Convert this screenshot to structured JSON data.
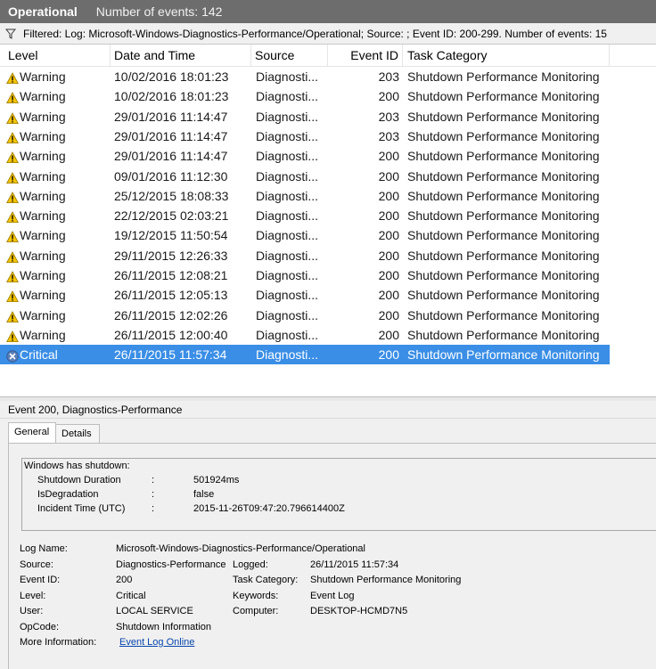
{
  "titlebar": {
    "title": "Operational",
    "count": "Number of events: 142"
  },
  "filter": {
    "text": "Filtered: Log: Microsoft-Windows-Diagnostics-Performance/Operational; Source: ; Event ID: 200-299. Number of events: 15"
  },
  "columns": {
    "level": "Level",
    "date": "Date and Time",
    "source": "Source",
    "eventid": "Event ID",
    "taskcat": "Task Category"
  },
  "rows": [
    {
      "level": "Warning",
      "date": "10/02/2016 18:01:23",
      "source": "Diagnosti...",
      "eventid": "203",
      "taskcat": "Shutdown Performance Monitoring"
    },
    {
      "level": "Warning",
      "date": "10/02/2016 18:01:23",
      "source": "Diagnosti...",
      "eventid": "200",
      "taskcat": "Shutdown Performance Monitoring"
    },
    {
      "level": "Warning",
      "date": "29/01/2016 11:14:47",
      "source": "Diagnosti...",
      "eventid": "203",
      "taskcat": "Shutdown Performance Monitoring"
    },
    {
      "level": "Warning",
      "date": "29/01/2016 11:14:47",
      "source": "Diagnosti...",
      "eventid": "203",
      "taskcat": "Shutdown Performance Monitoring"
    },
    {
      "level": "Warning",
      "date": "29/01/2016 11:14:47",
      "source": "Diagnosti...",
      "eventid": "200",
      "taskcat": "Shutdown Performance Monitoring"
    },
    {
      "level": "Warning",
      "date": "09/01/2016 11:12:30",
      "source": "Diagnosti...",
      "eventid": "200",
      "taskcat": "Shutdown Performance Monitoring"
    },
    {
      "level": "Warning",
      "date": "25/12/2015 18:08:33",
      "source": "Diagnosti...",
      "eventid": "200",
      "taskcat": "Shutdown Performance Monitoring"
    },
    {
      "level": "Warning",
      "date": "22/12/2015 02:03:21",
      "source": "Diagnosti...",
      "eventid": "200",
      "taskcat": "Shutdown Performance Monitoring"
    },
    {
      "level": "Warning",
      "date": "19/12/2015 11:50:54",
      "source": "Diagnosti...",
      "eventid": "200",
      "taskcat": "Shutdown Performance Monitoring"
    },
    {
      "level": "Warning",
      "date": "29/11/2015 12:26:33",
      "source": "Diagnosti...",
      "eventid": "200",
      "taskcat": "Shutdown Performance Monitoring"
    },
    {
      "level": "Warning",
      "date": "26/11/2015 12:08:21",
      "source": "Diagnosti...",
      "eventid": "200",
      "taskcat": "Shutdown Performance Monitoring"
    },
    {
      "level": "Warning",
      "date": "26/11/2015 12:05:13",
      "source": "Diagnosti...",
      "eventid": "200",
      "taskcat": "Shutdown Performance Monitoring"
    },
    {
      "level": "Warning",
      "date": "26/11/2015 12:02:26",
      "source": "Diagnosti...",
      "eventid": "200",
      "taskcat": "Shutdown Performance Monitoring"
    },
    {
      "level": "Warning",
      "date": "26/11/2015 12:00:40",
      "source": "Diagnosti...",
      "eventid": "200",
      "taskcat": "Shutdown Performance Monitoring"
    },
    {
      "level": "Critical",
      "date": "26/11/2015 11:57:34",
      "source": "Diagnosti...",
      "eventid": "200",
      "taskcat": "Shutdown Performance Monitoring",
      "selected": true
    }
  ],
  "detail": {
    "title": "Event 200, Diagnostics-Performance",
    "tabs": {
      "general": "General",
      "details": "Details"
    },
    "message": {
      "header": "Windows has shutdown:",
      "lines": [
        {
          "label": "Shutdown Duration",
          "sep": ":",
          "value": "501924ms"
        },
        {
          "label": "IsDegradation",
          "sep": ":",
          "value": "false"
        },
        {
          "label": "Incident Time (UTC)",
          "sep": ":",
          "value": "2015-11-26T09:47:20.796614400Z"
        }
      ]
    },
    "props": {
      "log_name_label": "Log Name:",
      "log_name": "Microsoft-Windows-Diagnostics-Performance/Operational",
      "source_label": "Source:",
      "source": "Diagnostics-Performance",
      "logged_label": "Logged:",
      "logged": "26/11/2015 11:57:34",
      "event_id_label": "Event ID:",
      "event_id": "200",
      "task_category_label": "Task Category:",
      "task_category": "Shutdown Performance Monitoring",
      "level_label": "Level:",
      "level": "Critical",
      "keywords_label": "Keywords:",
      "keywords": "Event Log",
      "user_label": "User:",
      "user": "LOCAL SERVICE",
      "computer_label": "Computer:",
      "computer": "DESKTOP-HCMD7N5",
      "opcode_label": "OpCode:",
      "opcode": "Shutdown Information",
      "more_info_label": "More Information:",
      "more_info": "Event Log Online"
    }
  },
  "icons": {
    "filter": "filter-icon",
    "warning": "warning-icon",
    "critical": "critical-icon"
  },
  "colors": {
    "selection": "#3a8ee6",
    "titlebar": "#6d6d6d",
    "warning": "#f5c400",
    "critical": "#5b7fb8",
    "link": "#0645ad"
  }
}
